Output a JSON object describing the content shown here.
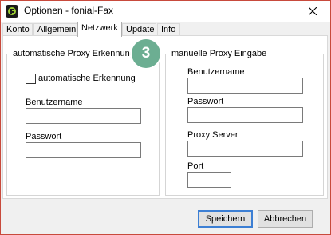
{
  "window": {
    "title": "Optionen - fonial-Fax"
  },
  "tabs": [
    {
      "label": "Konto",
      "active": false
    },
    {
      "label": "Allgemein",
      "active": false
    },
    {
      "label": "Netzwerk",
      "active": true
    },
    {
      "label": "Update",
      "active": false
    },
    {
      "label": "Info",
      "active": false
    }
  ],
  "badge": {
    "text": "3",
    "color": "#6cae92"
  },
  "auto_proxy": {
    "legend": "automatische Proxy Erkennung",
    "checkbox_label": "automatische Erkennung",
    "checked": false,
    "username_label": "Benutzername",
    "username_value": "",
    "password_label": "Passwort",
    "password_value": ""
  },
  "manual_proxy": {
    "legend": "manuelle Proxy Eingabe",
    "username_label": "Benutzername",
    "username_value": "",
    "password_label": "Passwort",
    "password_value": "",
    "server_label": "Proxy Server",
    "server_value": "",
    "port_label": "Port",
    "port_value": ""
  },
  "buttons": {
    "save": "Speichern",
    "cancel": "Abbrechen"
  },
  "colors": {
    "window_border": "#c84a3c",
    "default_button_border": "#3c7fd4"
  }
}
